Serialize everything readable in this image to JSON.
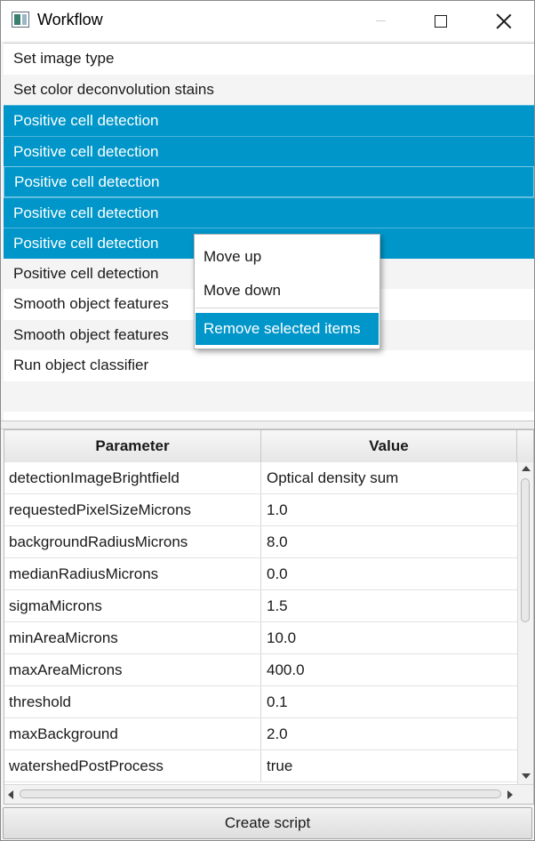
{
  "window": {
    "title": "Workflow"
  },
  "steps": [
    {
      "label": "Set image type",
      "selected": false
    },
    {
      "label": "Set color deconvolution stains",
      "selected": false
    },
    {
      "label": "Positive cell detection",
      "selected": true
    },
    {
      "label": "Positive cell detection",
      "selected": true
    },
    {
      "label": "Positive cell detection",
      "selected": true
    },
    {
      "label": "Positive cell detection",
      "selected": true
    },
    {
      "label": "Positive cell detection",
      "selected": true
    },
    {
      "label": "Positive cell detection",
      "selected": false
    },
    {
      "label": "Smooth object features",
      "selected": false
    },
    {
      "label": "Smooth object features",
      "selected": false
    },
    {
      "label": "Run object classifier",
      "selected": false
    }
  ],
  "context_menu": {
    "items": [
      "Move up",
      "Move down",
      "Remove selected items"
    ],
    "highlighted": "Remove selected items"
  },
  "table": {
    "headers": [
      "Parameter",
      "Value"
    ],
    "rows": [
      [
        "detectionImageBrightfield",
        "Optical density sum"
      ],
      [
        "requestedPixelSizeMicrons",
        "1.0"
      ],
      [
        "backgroundRadiusMicrons",
        "8.0"
      ],
      [
        "medianRadiusMicrons",
        "0.0"
      ],
      [
        "sigmaMicrons",
        "1.5"
      ],
      [
        "minAreaMicrons",
        "10.0"
      ],
      [
        "maxAreaMicrons",
        "400.0"
      ],
      [
        "threshold",
        "0.1"
      ],
      [
        "maxBackground",
        "2.0"
      ],
      [
        "watershedPostProcess",
        "true"
      ]
    ]
  },
  "footer": {
    "create_script_label": "Create script"
  },
  "colors": {
    "selection": "#0096c9",
    "selection_text": "#ffffff"
  }
}
